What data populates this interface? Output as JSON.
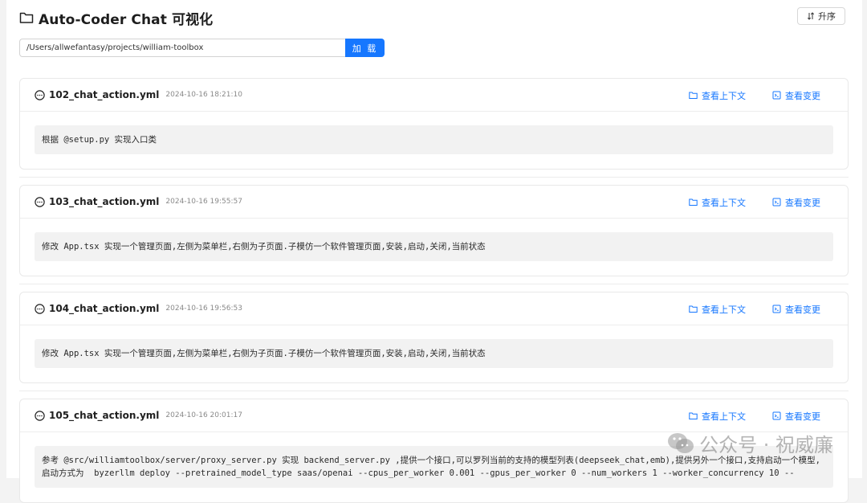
{
  "header": {
    "title": "Auto-Coder Chat 可视化",
    "sort_label": "升序"
  },
  "path_bar": {
    "value": "/Users/allwefantasy/projects/william-toolbox",
    "load_label": "加 载"
  },
  "actions": {
    "context_label": "查看上下文",
    "changes_label": "查看变更"
  },
  "cards": [
    {
      "name": "102_chat_action.yml",
      "time": "2024-10-16 18:21:10",
      "message": "根据 @setup.py 实现入口类"
    },
    {
      "name": "103_chat_action.yml",
      "time": "2024-10-16 19:55:57",
      "message": "修改 App.tsx 实现一个管理页面,左侧为菜单栏,右侧为子页面.子模仿一个软件管理页面,安装,启动,关闭,当前状态"
    },
    {
      "name": "104_chat_action.yml",
      "time": "2024-10-16 19:56:53",
      "message": "修改 App.tsx 实现一个管理页面,左侧为菜单栏,右侧为子页面.子模仿一个软件管理页面,安装,启动,关闭,当前状态"
    },
    {
      "name": "105_chat_action.yml",
      "time": "2024-10-16 20:01:17",
      "message": "参考 @src/williamtoolbox/server/proxy_server.py 实现 backend_server.py ,提供一个接口,可以罗列当前的支持的模型列表(deepseek_chat,emb),提供另外一个接口,支持启动一个模型,启动方式为  byzerllm deploy --pretrained_model_type saas/openai --cpus_per_worker 0.001 --gpus_per_worker 0 --num_workers 1 --worker_concurrency 10 --"
    }
  ],
  "watermark": "公众号 · 祝威廉"
}
